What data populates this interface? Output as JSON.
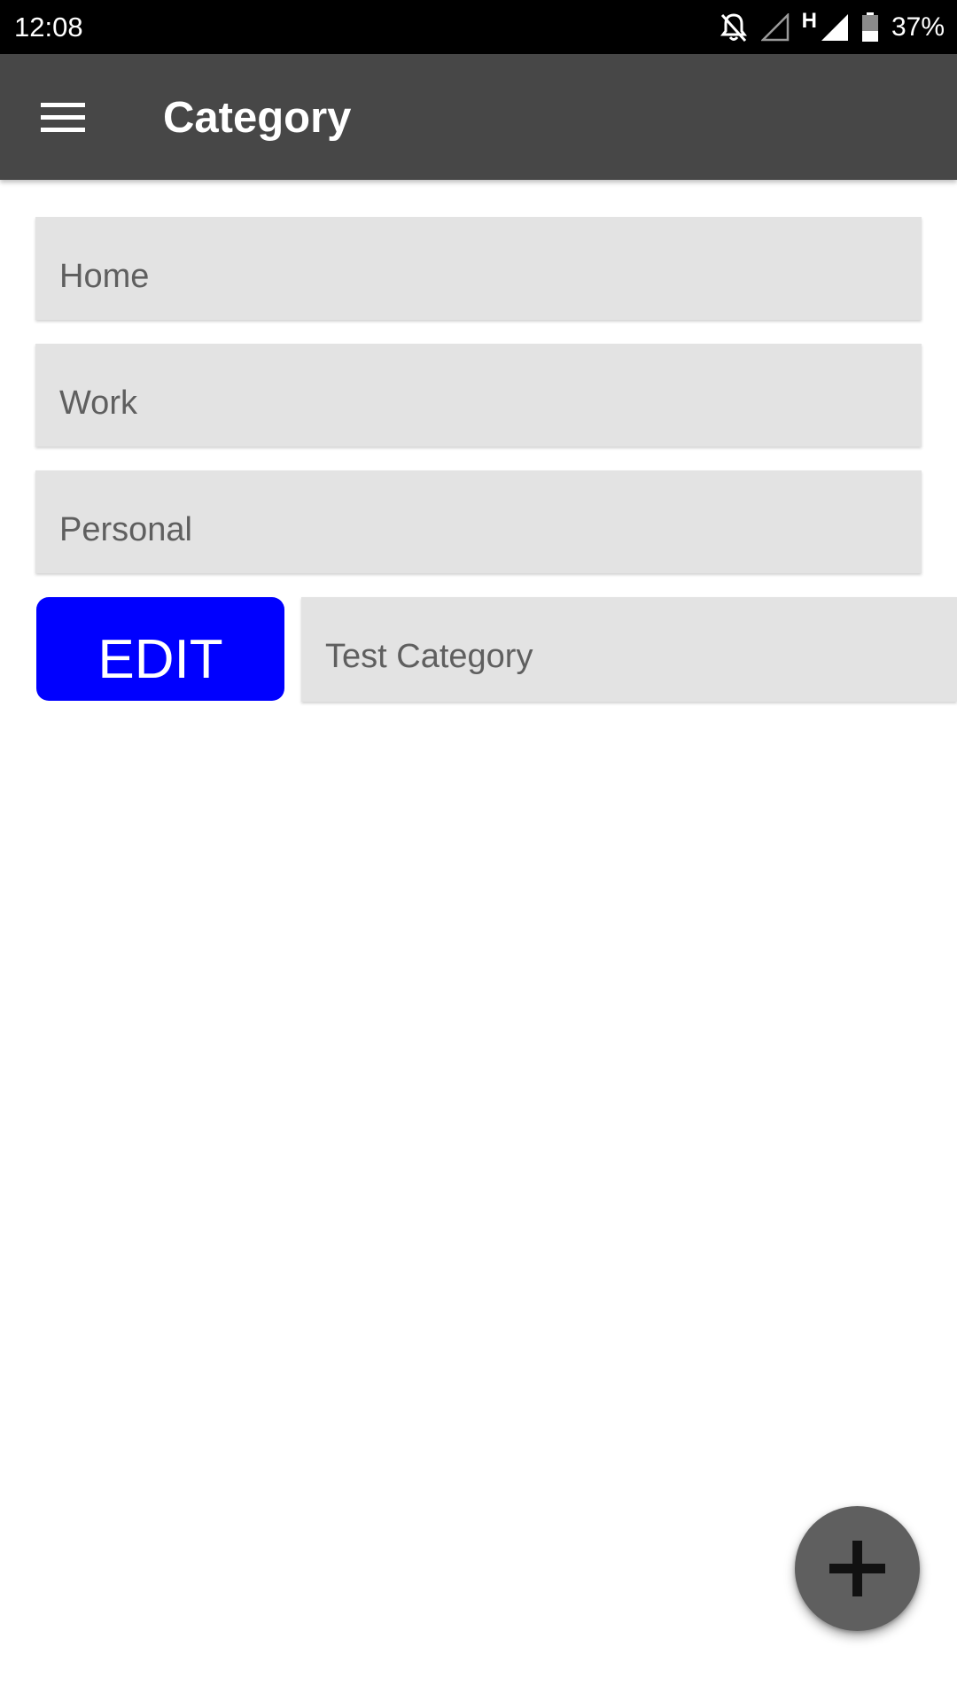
{
  "status_bar": {
    "time": "12:08",
    "network_type": "H",
    "battery_percent": "37%",
    "icons": [
      "bell-off-icon",
      "signal-empty-icon",
      "signal-full-icon",
      "battery-icon"
    ],
    "battery_level": 0.37
  },
  "app_bar": {
    "title": "Category",
    "menu_icon": "hamburger-menu-icon",
    "background_color": "#474747"
  },
  "categories": [
    {
      "label": "Home"
    },
    {
      "label": "Work"
    },
    {
      "label": "Personal"
    }
  ],
  "edit_row": {
    "button_label": "EDIT",
    "button_color": "#0000ff",
    "input_value": "Test Category"
  },
  "fab": {
    "icon": "plus-icon",
    "color": "#5f5f5f"
  }
}
